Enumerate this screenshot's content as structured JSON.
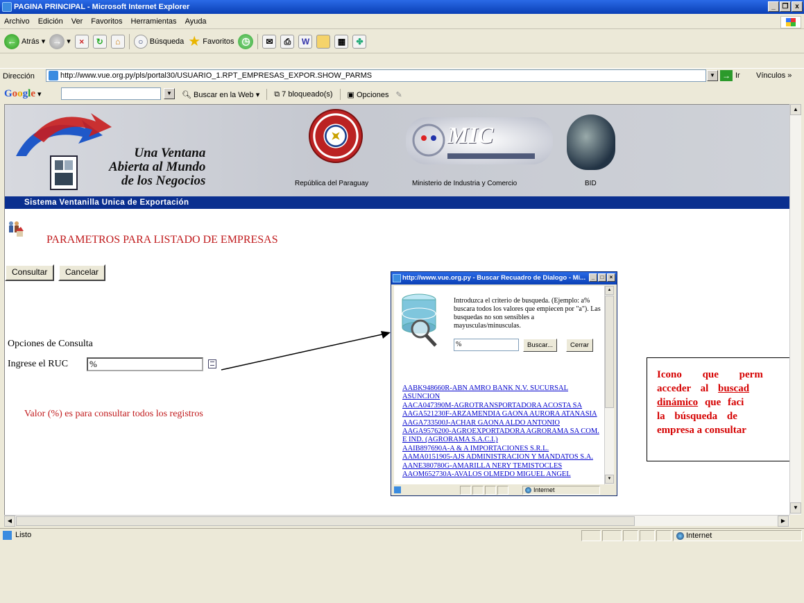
{
  "window": {
    "title": "PAGINA PRINCIPAL - Microsoft Internet Explorer",
    "buttons": [
      "_",
      "×",
      "x"
    ]
  },
  "menu": [
    "Archivo",
    "Edición",
    "Ver",
    "Favoritos",
    "Herramientas",
    "Ayuda"
  ],
  "toolbar": {
    "back": "Atrás",
    "search": "Búsqueda",
    "favorites": "Favoritos"
  },
  "address": {
    "label": "Dirección",
    "url": "http://www.vue.org.py/pls/portal30/USUARIO_1.RPT_EMPRESAS_EXPOR.SHOW_PARMS",
    "go": "Ir",
    "links": "Vínculos"
  },
  "googlebar": {
    "logo": "Google",
    "search_web": "Buscar en la Web",
    "blocked": "7 bloqueado(s)",
    "options": "Opciones"
  },
  "banner": {
    "slogan": [
      "Una Ventana",
      "Abierta al Mundo",
      "de los Negocios"
    ],
    "caption_paraguay": "República del Paraguay",
    "caption_mic": "Ministerio de Industria y Comercio",
    "caption_bid": "BID",
    "mic_logo": "MIC",
    "system_name": "Sistema Ventanilla Unica de Exportación"
  },
  "page": {
    "title": "PARAMETROS PARA LISTADO DE EMPRESAS",
    "consult_btn": "Consultar",
    "cancel_btn": "Cancelar",
    "options_label": "Opciones de Consulta",
    "ruc_label": "Ingrese el RUC",
    "ruc_value": "%",
    "note": "Valor (%) es para consultar todos los registros"
  },
  "callout": {
    "line1": "Icono que perm",
    "line2a": "acceder al ",
    "line2b": "buscad",
    "line3a": "dinámico",
    "line3b": " que faci",
    "line4": "la búsqueda de",
    "line5": "empresa a consultar"
  },
  "popup": {
    "title": "http://www.vue.org.py - Buscar Recuadro de Dialogo - Mi...",
    "instructions": "Introduzca el criterio de busqueda. (Ejemplo: a% buscara todos los valores que empiecen por \"a\"). Las busquedas no son sensibles a mayusculas/minusculas.",
    "input_value": "%",
    "search_btn": "Buscar...",
    "close_btn": "Cerrar",
    "results": [
      "AABK948660R-ABN AMRO BANK N.V. SUCURSAL ASUNCION",
      "AACA047390M-AGROTRANSPORTADORA ACOSTA SA",
      "AAGA521230F-ARZAMENDIA GAONA AURORA ATANASIA",
      "AAGA733500J-ACHAR GAONA ALDO ANTONIO",
      "AAGA9576200-AGROEXPORTADORA AGRORAMA SA COM. E IND. (AGRORAMA S.A.C.I.)",
      "AAIB897690A-A & A IMPORTACIONES S.R.L.",
      "AAMA0151905-AJS ADMINISTRACION Y MANDATOS S.A.",
      "AANE380780G-AMARILLA NERY TEMISTOCLES",
      "AAOM652730A-AVALOS OLMEDO MIGUEL ANGEL"
    ],
    "status_zone": "Internet"
  },
  "status": {
    "text": "Listo",
    "zone": "Internet"
  }
}
